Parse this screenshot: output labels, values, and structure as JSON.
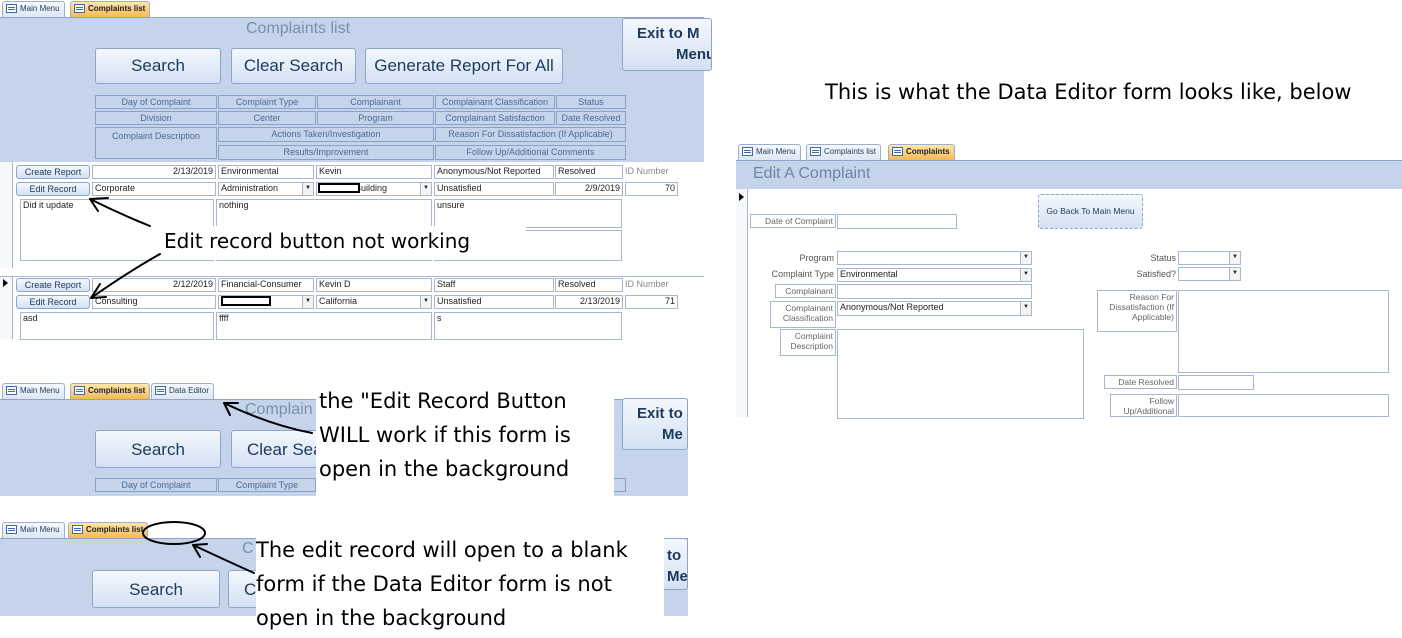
{
  "tabs_s1": [
    "Main Menu",
    "Complaints list"
  ],
  "tabs_s2": [
    "Main Menu",
    "Complaints list",
    "Data Editor"
  ],
  "tabs_s3": [
    "Main Menu",
    "Complaints list"
  ],
  "tabs_s4": [
    "Main Menu",
    "Complaints list",
    "Complaints"
  ],
  "complaints_list": {
    "title": "Complaints list",
    "search_label": "Search",
    "clear_search_label": "Clear Search",
    "generate_report_label": "Generate Report For All",
    "exit_label_line1": "Exit to M",
    "exit_label_line2": "Menu",
    "headers": {
      "day_of_complaint": "Day of Complaint",
      "complaint_type": "Complaint Type",
      "complainant": "Complainant",
      "complainant_classification": "Complainant Classification",
      "status": "Status",
      "division": "Division",
      "center": "Center",
      "program": "Program",
      "complainant_satisfaction": "Complainant Satisfaction",
      "date_resolved": "Date Resolved",
      "complaint_description": "Complaint Description",
      "actions_taken": "Actions Taken/Investigation",
      "reason_dissatisfaction": "Reason For Dissatisfaction (If Applicable)",
      "results": "Results/Improvement",
      "follow_up": "Follow Up/Additional Comments"
    },
    "create_report_label": "Create Report",
    "edit_record_label": "Edit Record",
    "id_number_label": "ID Number",
    "records": [
      {
        "date": "2/13/2019",
        "type": "Environmental",
        "complainant": "Kevin",
        "classification": "Anonymous/Not Reported",
        "status": "Resolved",
        "division": "Corporate",
        "center": "Administration",
        "program": "Building",
        "satisfaction": "Unsatisfied",
        "date_resolved": "2/9/2019",
        "id": "70",
        "description": "Did it update",
        "actions": "nothing",
        "reason": "unsure"
      },
      {
        "date": "2/12/2019",
        "type": "Financial-Consumer",
        "complainant": "Kevin D",
        "classification": "Staff",
        "status": "Resolved",
        "division": "Consulting",
        "center": "",
        "program": "California",
        "satisfaction": "Unsatisfied",
        "date_resolved": "2/13/2019",
        "id": "71",
        "description": "asd",
        "actions": "ffff",
        "reason": "s"
      }
    ]
  },
  "s2": {
    "title_partial": "Complain",
    "search_label": "Search",
    "clear_search_partial": "Clear Sea",
    "exit_line1": "Exit to",
    "exit_line2": "Me",
    "header_day": "Day of Complaint",
    "header_type": "Complaint Type"
  },
  "s3": {
    "title_partial": "C",
    "search_label": "Search",
    "clear_partial": "C",
    "exit_line1": "to",
    "exit_line2": "Me"
  },
  "annotations": {
    "edit_not_working": "Edit record button not working",
    "works_if_open": "the \"Edit Record Button WILL work if this form is open in the background",
    "blank_form": "The edit record will open to a blank form if the Data Editor form is not open in the background",
    "data_editor_caption": "This is what the Data Editor form looks like, below"
  },
  "edit_form": {
    "title": "Edit A Complaint",
    "date_of_complaint_label": "Date of Complaint",
    "go_back_label": "Go Back To Main Menu",
    "program_label": "Program",
    "complaint_type_label": "Complaint Type",
    "complaint_type_value": "Environmental",
    "complainant_label": "Complainant",
    "classification_label": "Complainant Classification",
    "classification_value": "Anonymous/Not Reported",
    "description_label": "Complaint Description",
    "status_label": "Status",
    "satisfied_label": "Satisfied?",
    "reason_label": "Reason For Dissatisfaction (If Applicable)",
    "date_resolved_label": "Date Resolved",
    "follow_up_label": "Follow Up/Additional"
  },
  "colors": {
    "panel": "#c5d4ea",
    "active_tab": "#f7b955",
    "header_text": "#4d6a93"
  }
}
